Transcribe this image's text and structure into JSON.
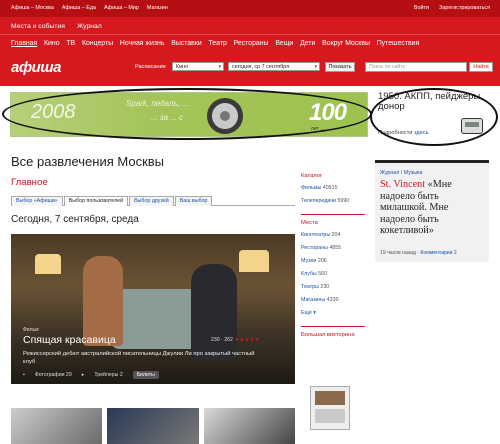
{
  "topbar": {
    "links": [
      "Афиша – Москва",
      "Афиша – Еда",
      "Афиша – Мир",
      "Магазин"
    ],
    "login": "Войти",
    "register": "Зарегистрироваться"
  },
  "nav1": {
    "tabs": [
      "Места и события",
      "Журнал"
    ]
  },
  "nav2": {
    "items": [
      "Главная",
      "Кино",
      "ТВ",
      "Концерты",
      "Ночная жизнь",
      "Выставки",
      "Театр",
      "Рестораны",
      "Вещи",
      "Дети",
      "Вокруг Москвы",
      "Путешествия"
    ]
  },
  "searchbar": {
    "logo": "афиша",
    "schedule_label": "Расписание",
    "category": "Кино",
    "date": "сегодня, ср 7 сентября",
    "show_button": "Показать",
    "site_search_placeholder": "Поиск по сайту",
    "go_button": "Найти"
  },
  "banner": {
    "year": "2008",
    "slogan1": "Spark, педаль, ...",
    "slogan2": "... за ... с",
    "big": "100",
    "caption": "лет ..."
  },
  "ad_right": {
    "text": "1950. АКПП, пейджеры, донор",
    "more_label": "Подробности",
    "more_link": "здесь"
  },
  "page": {
    "title": "Все развлечения Москвы",
    "section": "Главное",
    "subtabs": [
      "Выбор «Афиши»",
      "Выбор пользователей",
      "Выбор друзей",
      "Ваш выбор"
    ],
    "date_title": "Сегодня, 7 сентября, среда"
  },
  "feature": {
    "kicker": "Фильм",
    "title": "Спящая красавица",
    "rating_text": "230 · 262",
    "stars": "★★★★★",
    "description": "Режиссерский дебют австралийской писательницы Джулии Ли про закрытый частный клуб",
    "photos": "Фотографии 29",
    "trailers": "Трейлеры 2",
    "tickets": "Билеты"
  },
  "middle": {
    "catalog_title": "Каталог",
    "catalog": [
      {
        "label": "Фильмы",
        "count": "40915"
      },
      {
        "label": "Телепередачи",
        "count": "5990"
      }
    ],
    "places_title": "Места",
    "places": [
      {
        "label": "Кинотеатры",
        "count": "204"
      },
      {
        "label": "Рестораны",
        "count": "4855"
      },
      {
        "label": "Музеи",
        "count": "206"
      },
      {
        "label": "Клубы",
        "count": "560"
      },
      {
        "label": "Театры",
        "count": "230"
      },
      {
        "label": "Магазины",
        "count": "4330"
      }
    ],
    "more": "Ещё ▾",
    "quiz_title": "Большая викторина"
  },
  "sidecard": {
    "kicker": "Журнал / Музыка",
    "name": "St. Vincent",
    "quote": "«Мне надоело быть милашкой. Мне надоело быть кокетливой»",
    "time": "19 часов назад",
    "comments": "Комментарии 2"
  }
}
